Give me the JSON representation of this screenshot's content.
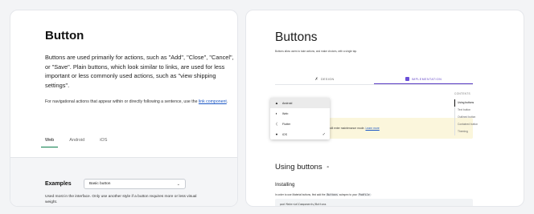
{
  "left": {
    "title": "Button",
    "description": "Buttons are used primarily for actions, such as \"Add\", \"Close\", \"Cancel\", or \"Save\". Plain buttons, which look similar to links, are used for less important or less commonly used actions, such as \"view shipping settings\".",
    "note_prefix": "For navigational actions that appear within or directly following a sentence, use the",
    "note_link": "link component",
    "note_suffix": ".",
    "tabs": [
      "Web",
      "Android",
      "iOS"
    ],
    "active_tab": "Web",
    "examples_label": "Examples",
    "select_value": "Basic button",
    "select_icon": "chevron-down-icon",
    "footnote": "Used most in the interface. Only use another style if a button requires more or less visual weight."
  },
  "right": {
    "title": "Buttons",
    "subtitle": "Buttons allow users to take actions, and make choices, with a single tap.",
    "tabs": [
      {
        "label": "DESIGN",
        "icon": "design-icon"
      },
      {
        "label": "IMPLEMENTATION",
        "icon": "implementation-icon"
      }
    ],
    "active_tab": "IMPLEMENTATION",
    "platform_menu": [
      {
        "label": "Android",
        "icon": "android-icon"
      },
      {
        "label": "Web",
        "icon": "web-icon"
      },
      {
        "label": "Flutter",
        "icon": "flutter-icon"
      },
      {
        "label": "iOS",
        "icon": "ios-icon",
        "selected": true
      }
    ],
    "notice_text": "iOS libraries will enter maintenance mode.",
    "notice_link": "Learn more",
    "using_heading": "Using buttons",
    "installing_heading": "Installing",
    "install_desc_prefix": "In order to use Material buttons, first add the",
    "install_code_name": "Buttons",
    "install_desc_mid": "subspec to your",
    "install_code_file": "Podfile",
    "install_desc_suffix": ":",
    "code": "pod MaterialComponents/Buttons",
    "toc_heading": "CONTENTS",
    "toc_items": [
      "Using buttons",
      "Text button",
      "Outlined button",
      "Contained button",
      "Theming"
    ],
    "toc_active": "Using buttons",
    "accent_color": "#5b3cc4"
  }
}
